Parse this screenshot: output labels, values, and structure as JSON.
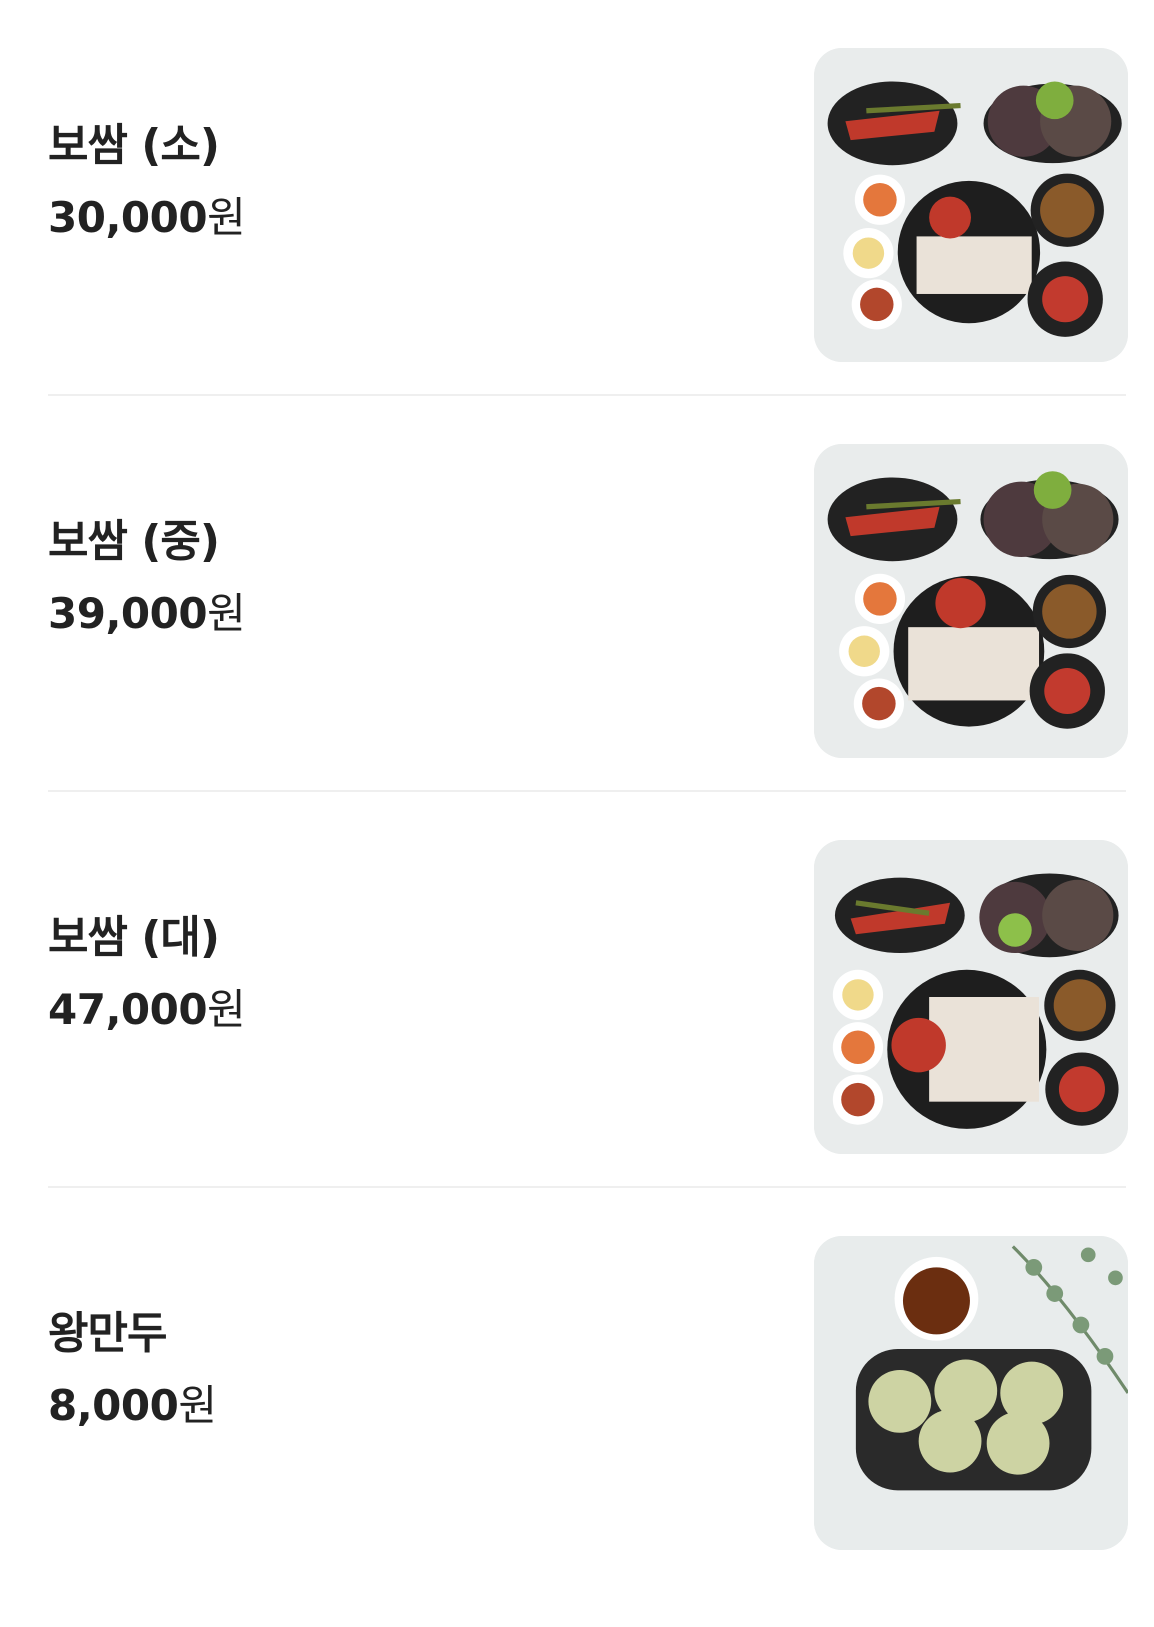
{
  "menu": {
    "items": [
      {
        "name": "보쌈 (소)",
        "price": "30,000",
        "currency": "원",
        "image": "bossam-small-photo"
      },
      {
        "name": "보쌈 (중)",
        "price": "39,000",
        "currency": "원",
        "image": "bossam-medium-photo"
      },
      {
        "name": "보쌈 (대)",
        "price": "47,000",
        "currency": "원",
        "image": "bossam-large-photo"
      },
      {
        "name": "왕만두",
        "price": "8,000",
        "currency": "원",
        "image": "dumpling-photo"
      }
    ]
  },
  "colors": {
    "text": "#222222",
    "divider": "#efefef",
    "photo_background": "#e9ecec"
  }
}
